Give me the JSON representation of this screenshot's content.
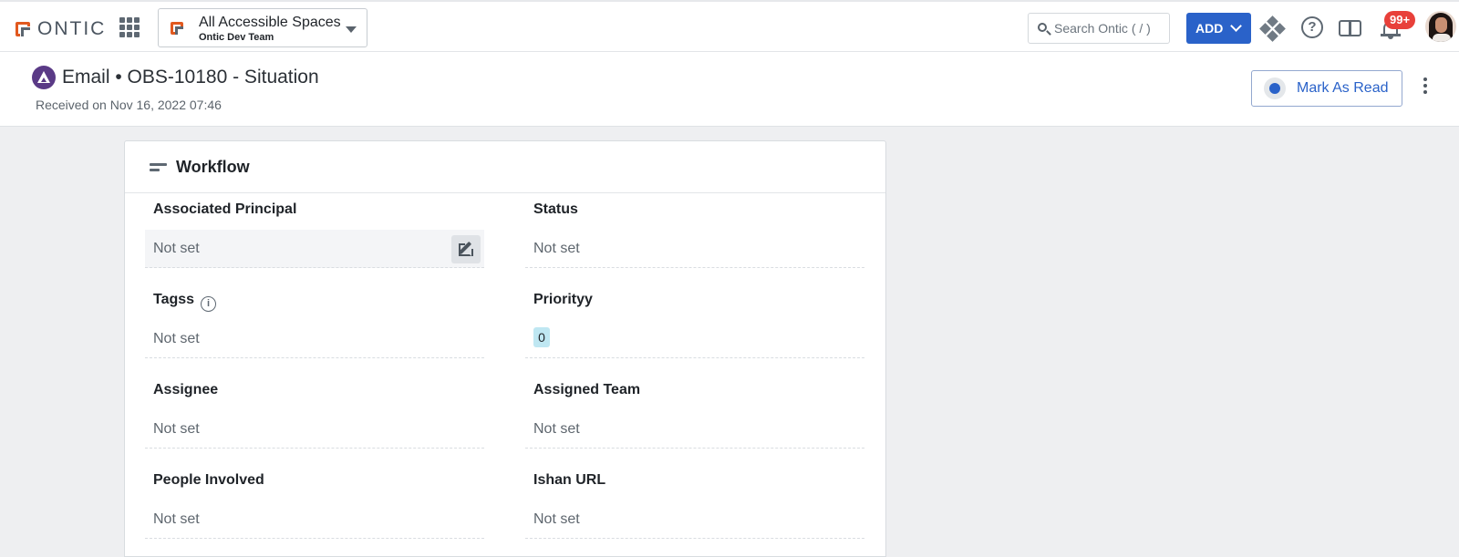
{
  "topbar": {
    "brand": "ONTIC",
    "space": {
      "title": "All Accessible Spaces",
      "subtitle": "Ontic Dev Team"
    },
    "search": {
      "placeholder": "Search Ontic ( / )",
      "value": ""
    },
    "add_label": "ADD",
    "notifications_count": "99+",
    "icons": [
      "apps-grid-icon",
      "search-icon",
      "chevron-down-icon",
      "diamond-apps-icon",
      "help-icon",
      "book-icon",
      "bell-icon",
      "avatar"
    ]
  },
  "header": {
    "title": "Email • OBS-10180 - Situation",
    "received": "Received on Nov 16, 2022 07:46",
    "mark_read_label": "Mark As Read"
  },
  "workflow": {
    "title": "Workflow",
    "fields": [
      {
        "label": "Associated Principal",
        "value": "Not set"
      },
      {
        "label": "Status",
        "value": "Not set"
      },
      {
        "label": "Tagss",
        "value": "Not set"
      },
      {
        "label": "Priorityy",
        "value": "0"
      },
      {
        "label": "Assignee",
        "value": "Not set"
      },
      {
        "label": "Assigned Team",
        "value": "Not set"
      },
      {
        "label": "People Involved",
        "value": "Not set"
      },
      {
        "label": "Ishan URL",
        "value": "Not set"
      }
    ]
  },
  "colors": {
    "accent": "#2a62c9",
    "brand_orange": "#e1591f",
    "badge_red": "#e8403a",
    "type_icon_purple": "#5a3a86",
    "priority_chip": "#bfe7f2"
  }
}
